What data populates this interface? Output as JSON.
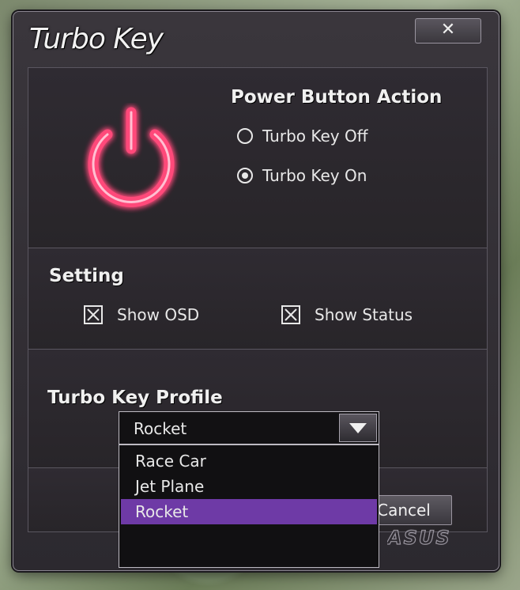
{
  "window": {
    "title": "Turbo Key",
    "close_glyph": "✕"
  },
  "power_section": {
    "heading": "Power Button Action",
    "icon": "power-icon",
    "icon_color": "#ff4a7a",
    "options": [
      {
        "label": "Turbo Key Off",
        "selected": false
      },
      {
        "label": "Turbo Key On",
        "selected": true
      }
    ]
  },
  "setting_section": {
    "heading": "Setting",
    "checkboxes": [
      {
        "label": "Show OSD",
        "checked": true
      },
      {
        "label": "Show Status",
        "checked": true
      }
    ]
  },
  "profile_section": {
    "heading": "Turbo Key Profile",
    "selected_value": "Rocket",
    "options": [
      "Race Car",
      "Jet Plane",
      "Rocket"
    ],
    "highlight_color": "#6e3aa6"
  },
  "buttons": {
    "cancel_label": "Cancel"
  },
  "brand": {
    "logo_text": "ASUS"
  }
}
